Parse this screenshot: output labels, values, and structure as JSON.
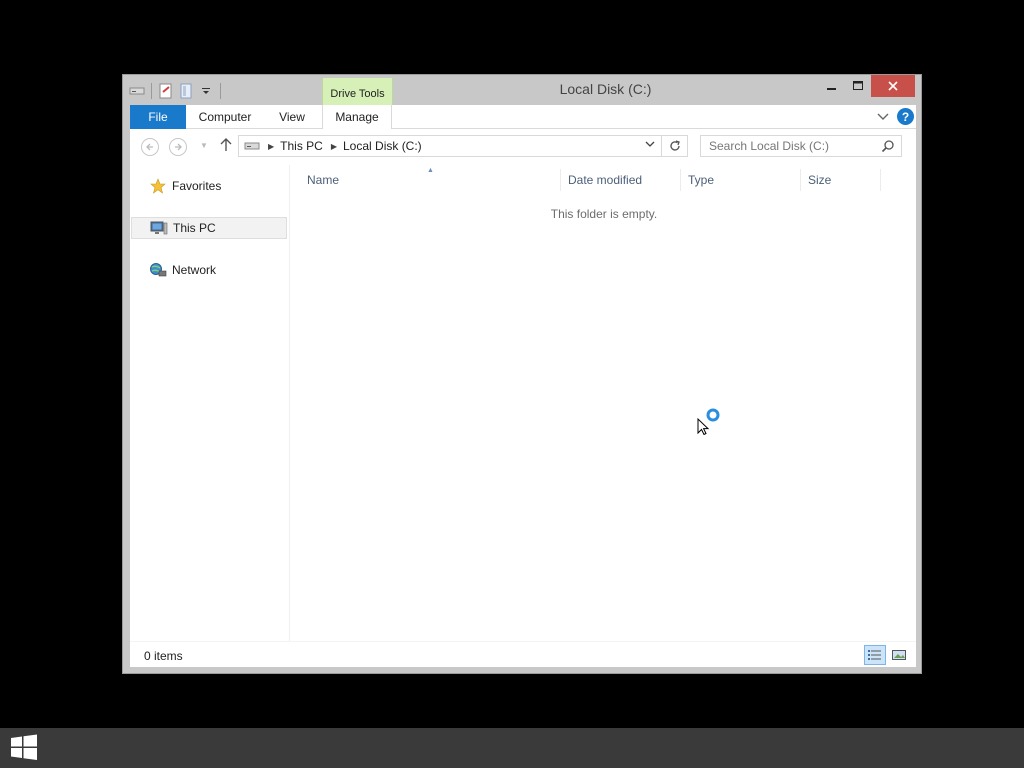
{
  "window": {
    "title": "Local Disk (C:)",
    "contextual_tab_group": "Drive Tools",
    "controls": {
      "minimize": "—",
      "maximize": "☐",
      "close": "✕"
    },
    "close_color": "#c7504a"
  },
  "quick_access": [
    {
      "icon": "drive-icon"
    },
    {
      "icon": "properties-icon"
    },
    {
      "icon": "new-folder-icon"
    },
    {
      "icon": "customize-qat-dropdown-icon"
    }
  ],
  "ribbon": {
    "tabs": [
      {
        "label": "File",
        "active": true
      },
      {
        "label": "Computer"
      },
      {
        "label": "View"
      },
      {
        "label": "Manage"
      }
    ],
    "accent_color": "#1979ca",
    "contextual_color": "#d7f0b8"
  },
  "address": {
    "crumbs": [
      "This PC",
      "Local Disk (C:)"
    ],
    "search_placeholder": "Search Local Disk (C:)"
  },
  "nav_pane": {
    "items": [
      {
        "label": "Favorites",
        "icon": "star-icon"
      },
      {
        "label": "This PC",
        "icon": "computer-icon",
        "selected": true
      },
      {
        "label": "Network",
        "icon": "network-icon"
      }
    ]
  },
  "file_list": {
    "columns": [
      "Name",
      "Date modified",
      "Type",
      "Size"
    ],
    "empty_message": "This folder is empty."
  },
  "status": {
    "item_count": "0 items",
    "view_buttons": [
      "details-view-icon",
      "large-icons-view-icon"
    ]
  }
}
